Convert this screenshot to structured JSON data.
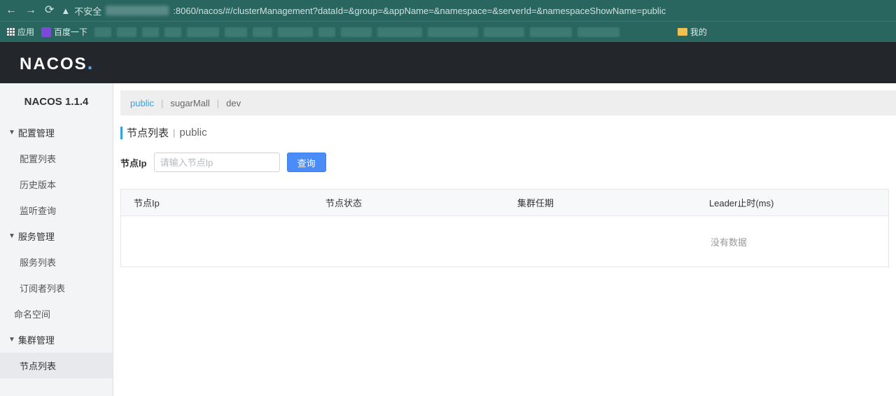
{
  "browser": {
    "insecure_label": "不安全",
    "url_suffix": ":8060/nacos/#/clusterManagement?dataId=&group=&appName=&namespace=&serverId=&namespaceShowName=public",
    "bookmarks": {
      "apps": "应用",
      "baidu": "百度一下",
      "mine": "我的"
    }
  },
  "header": {
    "logo_text": "NACOS"
  },
  "sidebar": {
    "title": "NACOS 1.1.4",
    "groups": [
      {
        "label": "配置管理",
        "items": [
          "配置列表",
          "历史版本",
          "监听查询"
        ]
      },
      {
        "label": "服务管理",
        "items": [
          "服务列表",
          "订阅者列表"
        ]
      }
    ],
    "single": "命名空间",
    "cluster": {
      "label": "集群管理",
      "items": [
        "节点列表"
      ],
      "active_index": 0
    }
  },
  "namespaces": [
    "public",
    "sugarMall",
    "dev"
  ],
  "active_namespace": "public",
  "page_title": {
    "main": "节点列表",
    "sub": "public"
  },
  "search": {
    "label": "节点Ip",
    "placeholder": "请输入节点Ip",
    "button": "查询"
  },
  "table": {
    "columns": [
      "节点Ip",
      "节点状态",
      "集群任期",
      "Leader止时(ms)"
    ],
    "empty": "没有数据"
  }
}
